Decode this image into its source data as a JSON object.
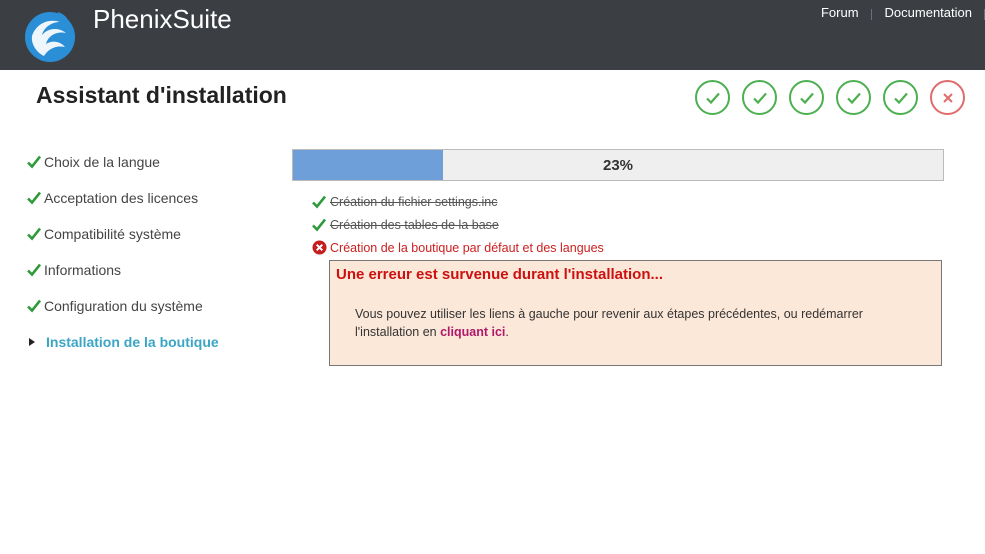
{
  "header": {
    "brand": "PhenixSuite",
    "nav": [
      "Forum",
      "Documentation"
    ],
    "colors": {
      "bar": "#3b3f44",
      "logo": "#2a8fd6"
    }
  },
  "page_title": "Assistant d'installation",
  "steps": [
    {
      "status": "done",
      "icon": "check-icon"
    },
    {
      "status": "done",
      "icon": "check-icon"
    },
    {
      "status": "done",
      "icon": "check-icon"
    },
    {
      "status": "done",
      "icon": "check-icon"
    },
    {
      "status": "done",
      "icon": "check-icon"
    },
    {
      "status": "error",
      "icon": "close-icon"
    }
  ],
  "sidebar": {
    "items": [
      {
        "label": "Choix de la langue",
        "status": "done"
      },
      {
        "label": "Acceptation des licences",
        "status": "done"
      },
      {
        "label": "Compatibilité système",
        "status": "done"
      },
      {
        "label": "Informations",
        "status": "done"
      },
      {
        "label": "Configuration du système",
        "status": "done"
      },
      {
        "label": "Installation de la boutique",
        "status": "current"
      }
    ],
    "colors": {
      "done": "#2e9a3a",
      "active": "#3aa5c4"
    }
  },
  "progress": {
    "percent": 23,
    "label": "23%",
    "color": "#6e9fd8"
  },
  "tasks": [
    {
      "label": "Création du fichier settings.inc",
      "status": "done"
    },
    {
      "label": "Création des tables de la base",
      "status": "done"
    },
    {
      "label": "Création de la boutique par défaut et des langues",
      "status": "failed"
    }
  ],
  "error": {
    "title": "Une erreur est survenue durant l'installation...",
    "message_before": "Vous pouvez utiliser les liens à gauche pour revenir aux étapes précédentes, ou redémarrer l'installation en ",
    "link_label": "cliquant ici",
    "message_after": "."
  }
}
